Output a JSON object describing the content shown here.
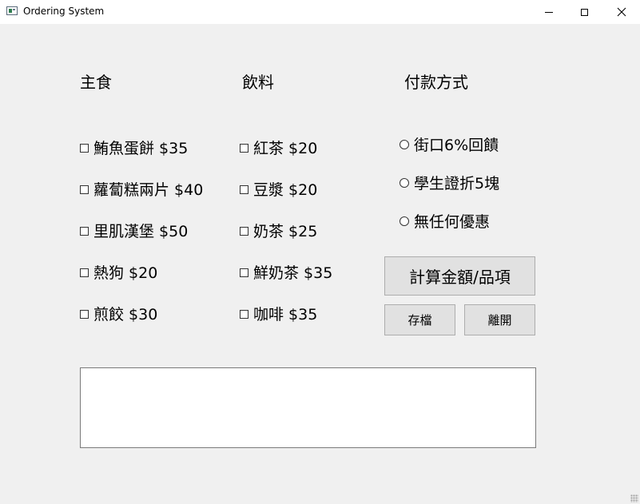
{
  "window": {
    "title": "Ordering System"
  },
  "headings": {
    "main": "主食",
    "drinks": "飲料",
    "payment": "付款方式"
  },
  "main_items": [
    "鮪魚蛋餅 $35",
    "蘿蔔糕兩片 $40",
    "里肌漢堡 $50",
    "熱狗 $20",
    "煎餃 $30"
  ],
  "drink_items": [
    "紅茶 $20",
    "豆漿 $20",
    "奶茶 $25",
    "鮮奶茶 $35",
    "咖啡 $35"
  ],
  "payment_options": [
    "街口6%回饋",
    "學生證折5塊",
    "無任何優惠"
  ],
  "buttons": {
    "calculate": "計算金額/品項",
    "save": "存檔",
    "exit": "離開"
  },
  "output": {
    "value": ""
  }
}
